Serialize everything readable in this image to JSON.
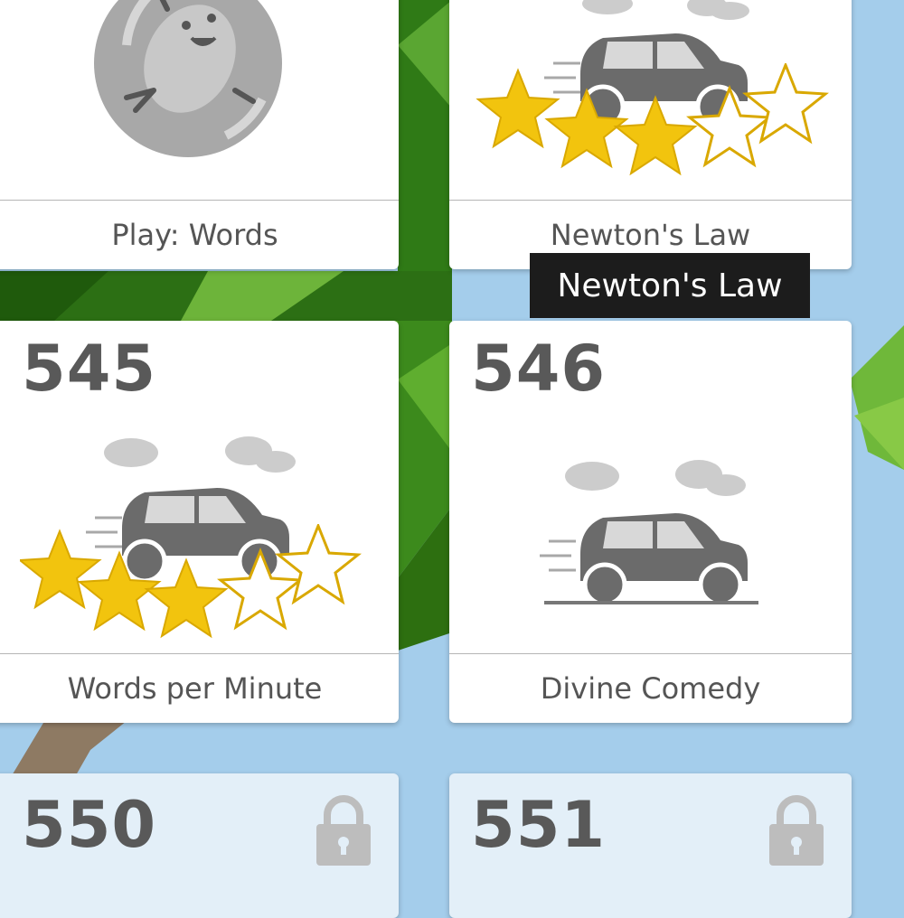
{
  "colors": {
    "background_sky": "#a4cdeb",
    "tree_green": "#3f8c1e",
    "card_bg": "#ffffff",
    "locked_card_bg": "#e3eff8",
    "number_text": "#595959",
    "star_gold": "#f1c40f",
    "car_gray": "#6b6b6b",
    "tooltip_bg": "#1c1c1c"
  },
  "cards": [
    {
      "number": "",
      "label": "Play: Words",
      "stars": null,
      "art": "typist-mascot-medallion"
    },
    {
      "number": "",
      "label": "Newton's Law",
      "stars": 3,
      "stars_max": 5,
      "art": "race-car-with-stars"
    },
    {
      "number": "545",
      "label": "Words per Minute",
      "stars": 3,
      "stars_max": 5,
      "art": "race-car-with-stars"
    },
    {
      "number": "546",
      "label": "Divine Comedy",
      "stars": 0,
      "stars_max": 5,
      "art": "race-car"
    },
    {
      "number": "550",
      "label": "",
      "locked": true,
      "art": "lock-icon"
    },
    {
      "number": "551",
      "label": "",
      "locked": true,
      "art": "lock-icon"
    }
  ],
  "tooltip": {
    "text": "Newton's Law"
  }
}
